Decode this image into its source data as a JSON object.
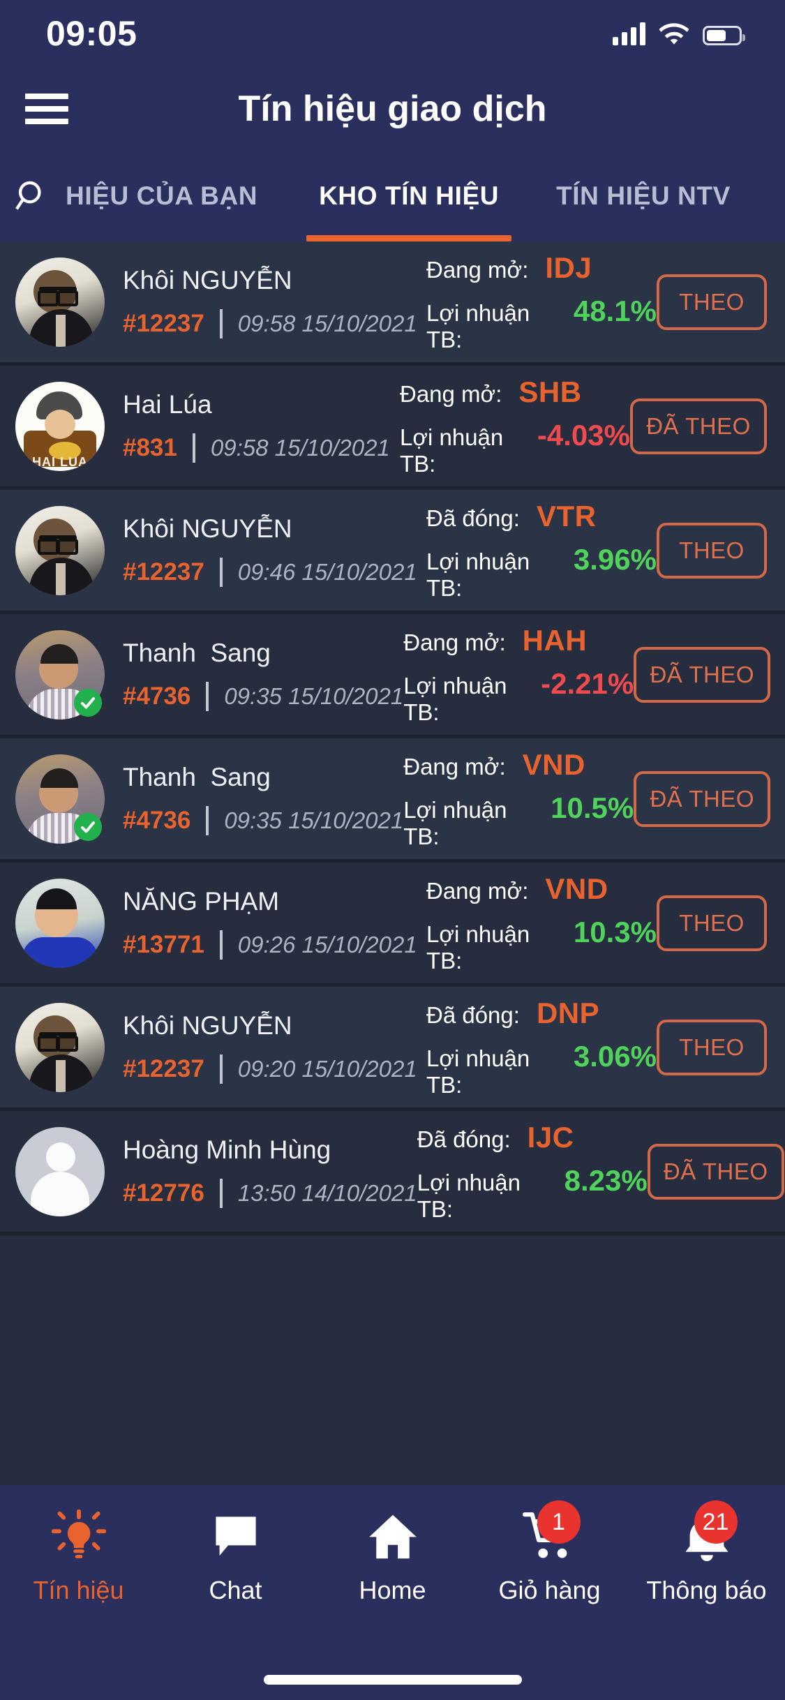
{
  "status_bar": {
    "time": "09:05",
    "signal_icon": "cellular-signal-icon",
    "wifi_icon": "wifi-icon",
    "battery_icon": "battery-icon"
  },
  "nav": {
    "menu_icon": "hamburger-menu-icon",
    "title": "Tín hiệu giao dịch"
  },
  "tabs": {
    "search_icon": "search-icon",
    "items": [
      {
        "label": "HIỆU CỦA BẠN",
        "active": false
      },
      {
        "label": "KHO TÍN HIỆU",
        "active": true
      },
      {
        "label": "TÍN HIỆU NTV",
        "active": false
      }
    ]
  },
  "colors": {
    "accent_orange": "#e8632e",
    "header_navy": "#2a2f5e",
    "list_bg": "#262d3f",
    "row_alt_bg": "#2b3346",
    "profit_up_green": "#4fd35a",
    "profit_down_red": "#ef4a4d",
    "button_border": "#d4694a",
    "badge_red": "#e8332e",
    "verified_green": "#22b14c"
  },
  "list": {
    "status_label_open": "Đang mở:",
    "status_label_closed": "Đã đóng:",
    "profit_label": "Lợi nhuận TB:",
    "rows": [
      {
        "name": "Khôi NGUYỄN",
        "uid": "#12237",
        "time": "09:58 15/10/2021",
        "status": "Đang mở:",
        "ticker": "IDJ",
        "profit_label": "Lợi nhuận TB:",
        "profit": "48.1%",
        "profit_dir": "up",
        "button": "THEO",
        "followed": false,
        "verified": false,
        "avatar": "av-khoi"
      },
      {
        "name": "Hai Lúa",
        "uid": "#831",
        "time": "09:58 15/10/2021",
        "status": "Đang mở:",
        "ticker": "SHB",
        "profit_label": "Lợi nhuận TB:",
        "profit": "-4.03%",
        "profit_dir": "down",
        "button": "ĐÃ THEO",
        "followed": true,
        "verified": false,
        "avatar": "av-hailua"
      },
      {
        "name": "Khôi NGUYỄN",
        "uid": "#12237",
        "time": "09:46 15/10/2021",
        "status": "Đã đóng:",
        "ticker": "VTR",
        "profit_label": "Lợi nhuận TB:",
        "profit": "3.96%",
        "profit_dir": "up",
        "button": "THEO",
        "followed": false,
        "verified": false,
        "avatar": "av-khoi"
      },
      {
        "name": "Thanh  Sang",
        "uid": "#4736",
        "time": "09:35 15/10/2021",
        "status": "Đang mở:",
        "ticker": "HAH",
        "profit_label": "Lợi nhuận TB:",
        "profit": "-2.21%",
        "profit_dir": "down",
        "button": "ĐÃ THEO",
        "followed": true,
        "verified": true,
        "avatar": "av-sang"
      },
      {
        "name": "Thanh  Sang",
        "uid": "#4736",
        "time": "09:35 15/10/2021",
        "status": "Đang mở:",
        "ticker": "VND",
        "profit_label": "Lợi nhuận TB:",
        "profit": "10.5%",
        "profit_dir": "up",
        "button": "ĐÃ THEO",
        "followed": true,
        "verified": true,
        "avatar": "av-sang"
      },
      {
        "name": "NĂNG PHẠM",
        "uid": "#13771",
        "time": "09:26 15/10/2021",
        "status": "Đang mở:",
        "ticker": "VND",
        "profit_label": "Lợi nhuận TB:",
        "profit": "10.3%",
        "profit_dir": "up",
        "button": "THEO",
        "followed": false,
        "verified": false,
        "avatar": "av-nang"
      },
      {
        "name": "Khôi NGUYỄN",
        "uid": "#12237",
        "time": "09:20 15/10/2021",
        "status": "Đã đóng:",
        "ticker": "DNP",
        "profit_label": "Lợi nhuận TB:",
        "profit": "3.06%",
        "profit_dir": "up",
        "button": "THEO",
        "followed": false,
        "verified": false,
        "avatar": "av-khoi"
      },
      {
        "name": "Hoàng Minh Hùng",
        "uid": "#12776",
        "time": "13:50 14/10/2021",
        "status": "Đã đóng:",
        "ticker": "IJC",
        "profit_label": "Lợi nhuận TB:",
        "profit": "8.23%",
        "profit_dir": "up",
        "button": "ĐÃ THEO",
        "followed": true,
        "verified": false,
        "avatar": "av-blank"
      }
    ]
  },
  "bottom_nav": {
    "items": [
      {
        "label": "Tín hiệu",
        "icon": "lightbulb-icon",
        "active": true,
        "badge": null
      },
      {
        "label": "Chat",
        "icon": "chat-bubble-icon",
        "active": false,
        "badge": null
      },
      {
        "label": "Home",
        "icon": "home-icon",
        "active": false,
        "badge": null
      },
      {
        "label": "Giỏ hàng",
        "icon": "shopping-cart-icon",
        "active": false,
        "badge": "1"
      },
      {
        "label": "Thông báo",
        "icon": "bell-icon",
        "active": false,
        "badge": "21"
      }
    ]
  }
}
